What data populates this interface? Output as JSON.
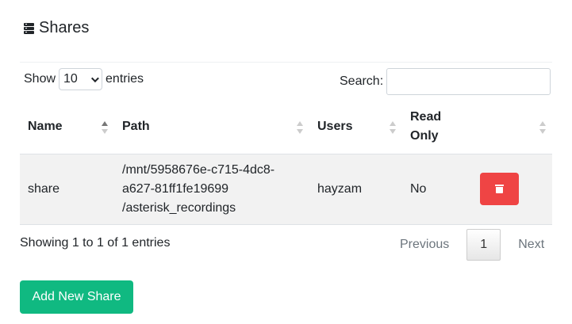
{
  "header": {
    "icon": "server-icon",
    "title": "Shares"
  },
  "length": {
    "show_label": "Show",
    "selected": "10",
    "entries_label": "entries"
  },
  "search": {
    "label": "Search:",
    "value": "",
    "placeholder": ""
  },
  "table": {
    "columns": [
      {
        "label": "Name",
        "sort": "asc"
      },
      {
        "label": "Path",
        "sort": "none"
      },
      {
        "label": "Users",
        "sort": "none"
      },
      {
        "label": "Read Only",
        "sort": "none"
      },
      {
        "label": "",
        "sort": "none"
      }
    ],
    "rows": [
      {
        "name": "share",
        "path_lines": [
          "/mnt/5958676e-c715-4dc8-",
          "a627-81ff1fe19699",
          "/asterisk_recordings"
        ],
        "users": "hayzam",
        "read_only": "No",
        "action_icon": "trash-icon"
      }
    ]
  },
  "info": "Showing 1 to 1 of 1 entries",
  "pagination": {
    "previous": "Previous",
    "current": "1",
    "next": "Next"
  },
  "add_button": "Add New Share",
  "colors": {
    "danger": "#ef4444",
    "success": "#10b981"
  }
}
